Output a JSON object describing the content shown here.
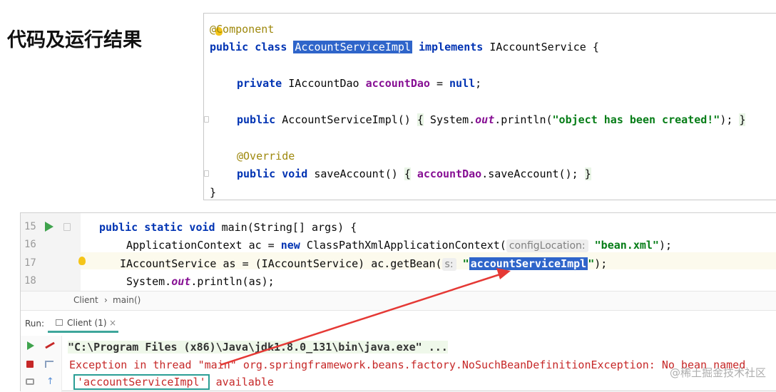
{
  "heading": "代码及运行结果",
  "top_code": {
    "annotation_component": "@Component",
    "class_line": {
      "public_class": "public class",
      "class_name": "AccountServiceImpl",
      "implements": "implements",
      "interface_and_brace": "IAccountService {"
    },
    "field_line": {
      "private": "private",
      "type": "IAccountDao",
      "name": "accountDao",
      "assign": " = ",
      "null": "null",
      "semi": ";"
    },
    "ctor_line": {
      "public": "public",
      "sig": "AccountServiceImpl()",
      "open": "{",
      "system": " System.",
      "out": "out",
      "println": ".println(",
      "str": "\"object has been created!\"",
      "end": "); ",
      "close": "}"
    },
    "override": "@Override",
    "method_line": {
      "public_void": "public void",
      "sig": "saveAccount()",
      "open": "{",
      "field": "accountDao",
      "call": ".saveAccount(); ",
      "close": "}"
    },
    "class_close": "}"
  },
  "editor": {
    "lines": [
      {
        "num": "15"
      },
      {
        "num": "16"
      },
      {
        "num": "17"
      },
      {
        "num": "18"
      }
    ],
    "l15": {
      "kw": "public static void",
      "rest": " main(String[] args) {"
    },
    "l16": {
      "pre": "ApplicationContext ac = ",
      "kw": "new",
      "mid": " ClassPathXmlApplicationContext(",
      "hint": "configLocation:",
      "str": "\"bean.xml\"",
      "end": ");"
    },
    "l17": {
      "pre": "IAccountService as = (IAccountService) ac.getBean(",
      "hint": "s:",
      "q1": "\"",
      "sel": "accountServiceImpl",
      "q2": "\"",
      "end": ");"
    },
    "l18": {
      "pre": "System.",
      "out": "out",
      "end": ".println(as);"
    }
  },
  "breadcrumbs": {
    "item1": "Client",
    "sep": "›",
    "item2": "main()"
  },
  "run": {
    "label": "Run:",
    "tab": "Client (1)",
    "tab_close": "×"
  },
  "console": {
    "cmd": "\"C:\\Program Files (x86)\\Java\\jdk1.8.0_131\\bin\\java.exe\" ...",
    "exception": "Exception in thread \"main\" org.springframework.beans.factory.NoSuchBeanDefinitionException: No bean named",
    "boxed": "'accountServiceImpl'",
    "available": " available"
  },
  "watermark": "@稀土掘金技术社区",
  "colors": {
    "selection": "#2f65ca",
    "arrow": "#e53935",
    "run_green": "#3fa34d",
    "error_red": "#c62828",
    "teal_box": "#2a9e95"
  }
}
